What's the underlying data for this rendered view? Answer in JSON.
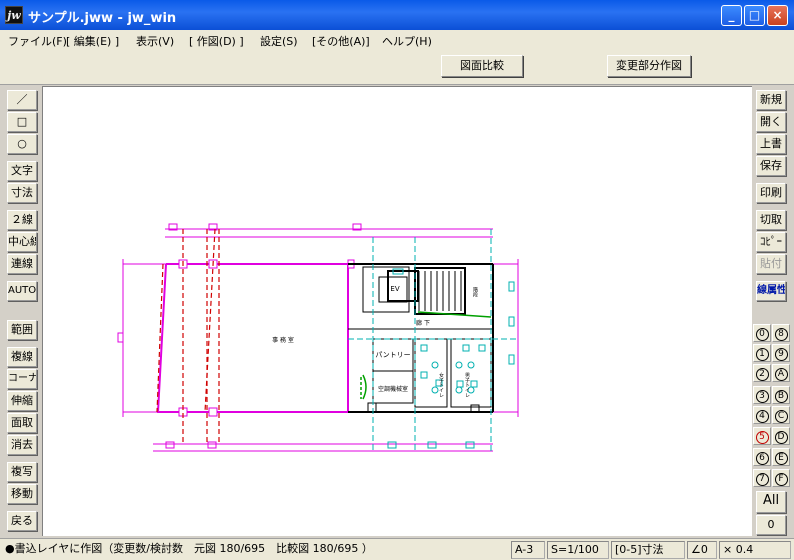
{
  "window": {
    "app_icon": "jw",
    "title": "サンプル.jww - jw_win",
    "minimize": "_",
    "maximize": "□",
    "close": "×"
  },
  "menu": [
    "ファイル(F)",
    "[ 編集(E) ]",
    "表示(V)",
    "[ 作図(D) ]",
    "設定(S)",
    "[その他(A)]",
    "ヘルプ(H)"
  ],
  "toolbar": {
    "compare": "図面比較",
    "partial": "変更部分作図"
  },
  "left_tools": [
    "／",
    "□",
    "○",
    "文字",
    "寸法",
    "２線",
    "中心線",
    "連線",
    "AUTO",
    "範囲",
    "複線",
    "コーナー",
    "伸縮",
    "面取",
    "消去",
    "複写",
    "移動",
    "戻る"
  ],
  "right_tools": [
    "新規",
    "開く",
    "上書",
    "保存",
    "印刷",
    "切取",
    "ｺﾋﾟｰ",
    "貼付",
    "線属性"
  ],
  "layers_left": [
    "0",
    "1",
    "2",
    "3",
    "4",
    "5",
    "6",
    "7"
  ],
  "layers_right": [
    "8",
    "9",
    "A",
    "B",
    "C",
    "D",
    "E",
    "F"
  ],
  "layer_all": "All",
  "layer_zero": "0",
  "drawing": {
    "room_main": "事 務 室",
    "ev": "EV",
    "corridor": "廊 下",
    "pantry": "パントリー",
    "aircon": "空調機械室",
    "toilet_a": "女子トイレ",
    "toilet_b": "男子トイレ",
    "stair": "階段"
  },
  "status": {
    "message": "●書込レイヤに作図（変更数/検討数　元図 180/695　比較図 180/695 ）",
    "paper": "A-3",
    "scale": "S=1/100",
    "dim": "[0-5]寸法",
    "angle": "∠0",
    "zoom": "× 0.4"
  }
}
